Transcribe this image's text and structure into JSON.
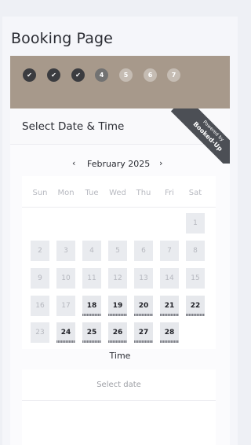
{
  "page": {
    "title": "Booking Page"
  },
  "steps": [
    {
      "label": "✔",
      "state": "done"
    },
    {
      "label": "✔",
      "state": "done"
    },
    {
      "label": "✔",
      "state": "done"
    },
    {
      "label": "4",
      "state": "current"
    },
    {
      "label": "5",
      "state": "todo"
    },
    {
      "label": "6",
      "state": "todo"
    },
    {
      "label": "7",
      "state": "todo"
    }
  ],
  "header": {
    "title": "Select Date & Time"
  },
  "ribbon": {
    "line1": "Powered by",
    "line2": "Booked-Up"
  },
  "calendar": {
    "prev": "‹",
    "next": "›",
    "month": "February 2025",
    "weekdays": [
      "Sun",
      "Mon",
      "Tue",
      "Wed",
      "Thu",
      "Fri",
      "Sat"
    ],
    "days": [
      [
        "1"
      ],
      [
        "2",
        "3",
        "4",
        "5",
        "6",
        "7",
        "8"
      ],
      [
        "9",
        "10",
        "11",
        "12",
        "13",
        "14",
        "15"
      ],
      [
        "16",
        "17",
        "18",
        "19",
        "20",
        "21",
        "22"
      ],
      [
        "23",
        "24",
        "25",
        "26",
        "27",
        "28"
      ]
    ],
    "available": [
      "18",
      "19",
      "20",
      "21",
      "22",
      "24",
      "25",
      "26",
      "27",
      "28"
    ]
  },
  "time": {
    "label": "Time",
    "placeholder": "Select date"
  },
  "colors": {
    "steps_bar": "#a7998b",
    "step_done": "#3b3c40",
    "ribbon": "#4c4f55"
  }
}
